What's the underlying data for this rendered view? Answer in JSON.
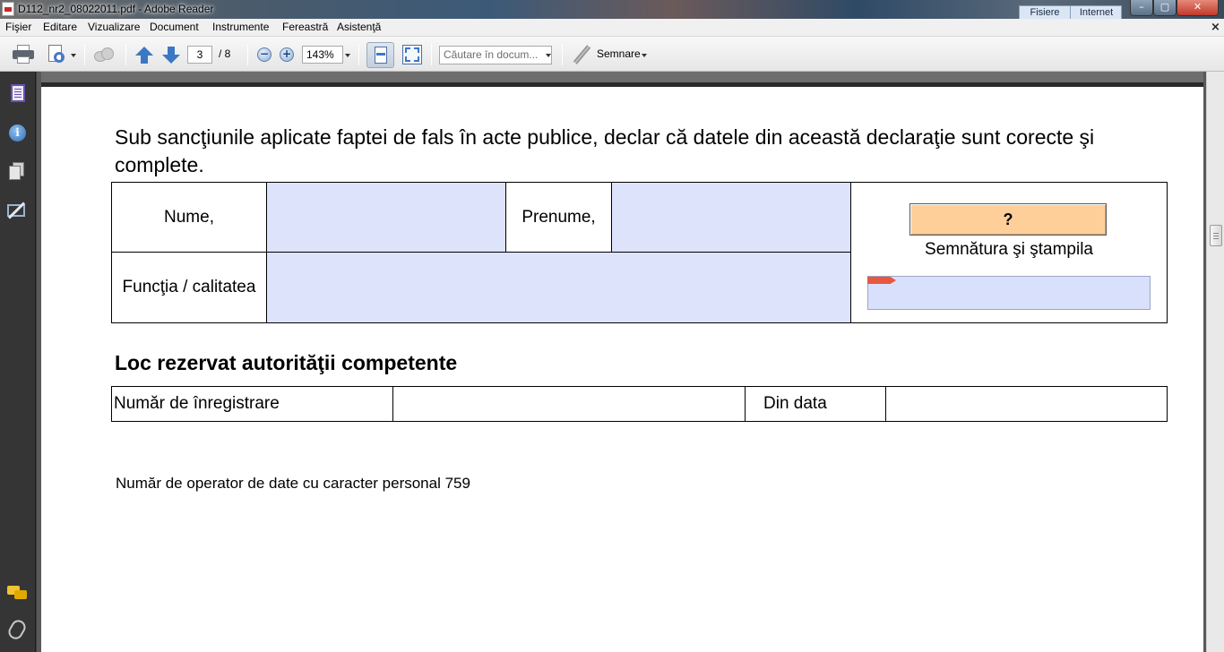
{
  "window": {
    "title": "D112_nr2_08022011.pdf - Adobe Reader",
    "minimize_label": "–",
    "maximize_label": "▢",
    "close_label": "✕"
  },
  "overlay_panel": {
    "col1": "Fisiere",
    "col2": "Internet"
  },
  "menu": {
    "items": [
      "Fişier",
      "Editare",
      "Vizualizare",
      "Document",
      "Instrumente",
      "Fereastră",
      "Asistenţă"
    ],
    "close_doc": "×"
  },
  "toolbar": {
    "page_current": "3",
    "page_total": "/ 8",
    "zoom_out": "−",
    "zoom_in": "+",
    "zoom_value": "143%",
    "search_placeholder": "Căutare în docum...",
    "sign_label": "Semnare"
  },
  "document": {
    "declaration": "Sub sancţiunile aplicate faptei de fals în acte publice, declar că datele din această declaraţie sunt corecte şi complete.",
    "form": {
      "nume_label": "Nume,",
      "prenume_label": "Prenume,",
      "functia_label": "Funcţia / calitatea",
      "signature_button": "?",
      "signature_label": "Semnătura şi ştampila"
    },
    "section_title": "Loc rezervat autorităţii competente",
    "registration": {
      "number_label": "Număr de înregistrare",
      "date_label": "Din data"
    },
    "operator_line": "Număr de operator de date cu caracter personal 759"
  },
  "icons": {
    "left_panel": [
      "pages-icon",
      "info-icon",
      "documents-icon",
      "signature-icon",
      "comment-icon",
      "attachment-icon"
    ]
  },
  "colors": {
    "form_field": "#dde3fb",
    "signature_button": "#ffcf99",
    "panel_bg": "#353535"
  }
}
